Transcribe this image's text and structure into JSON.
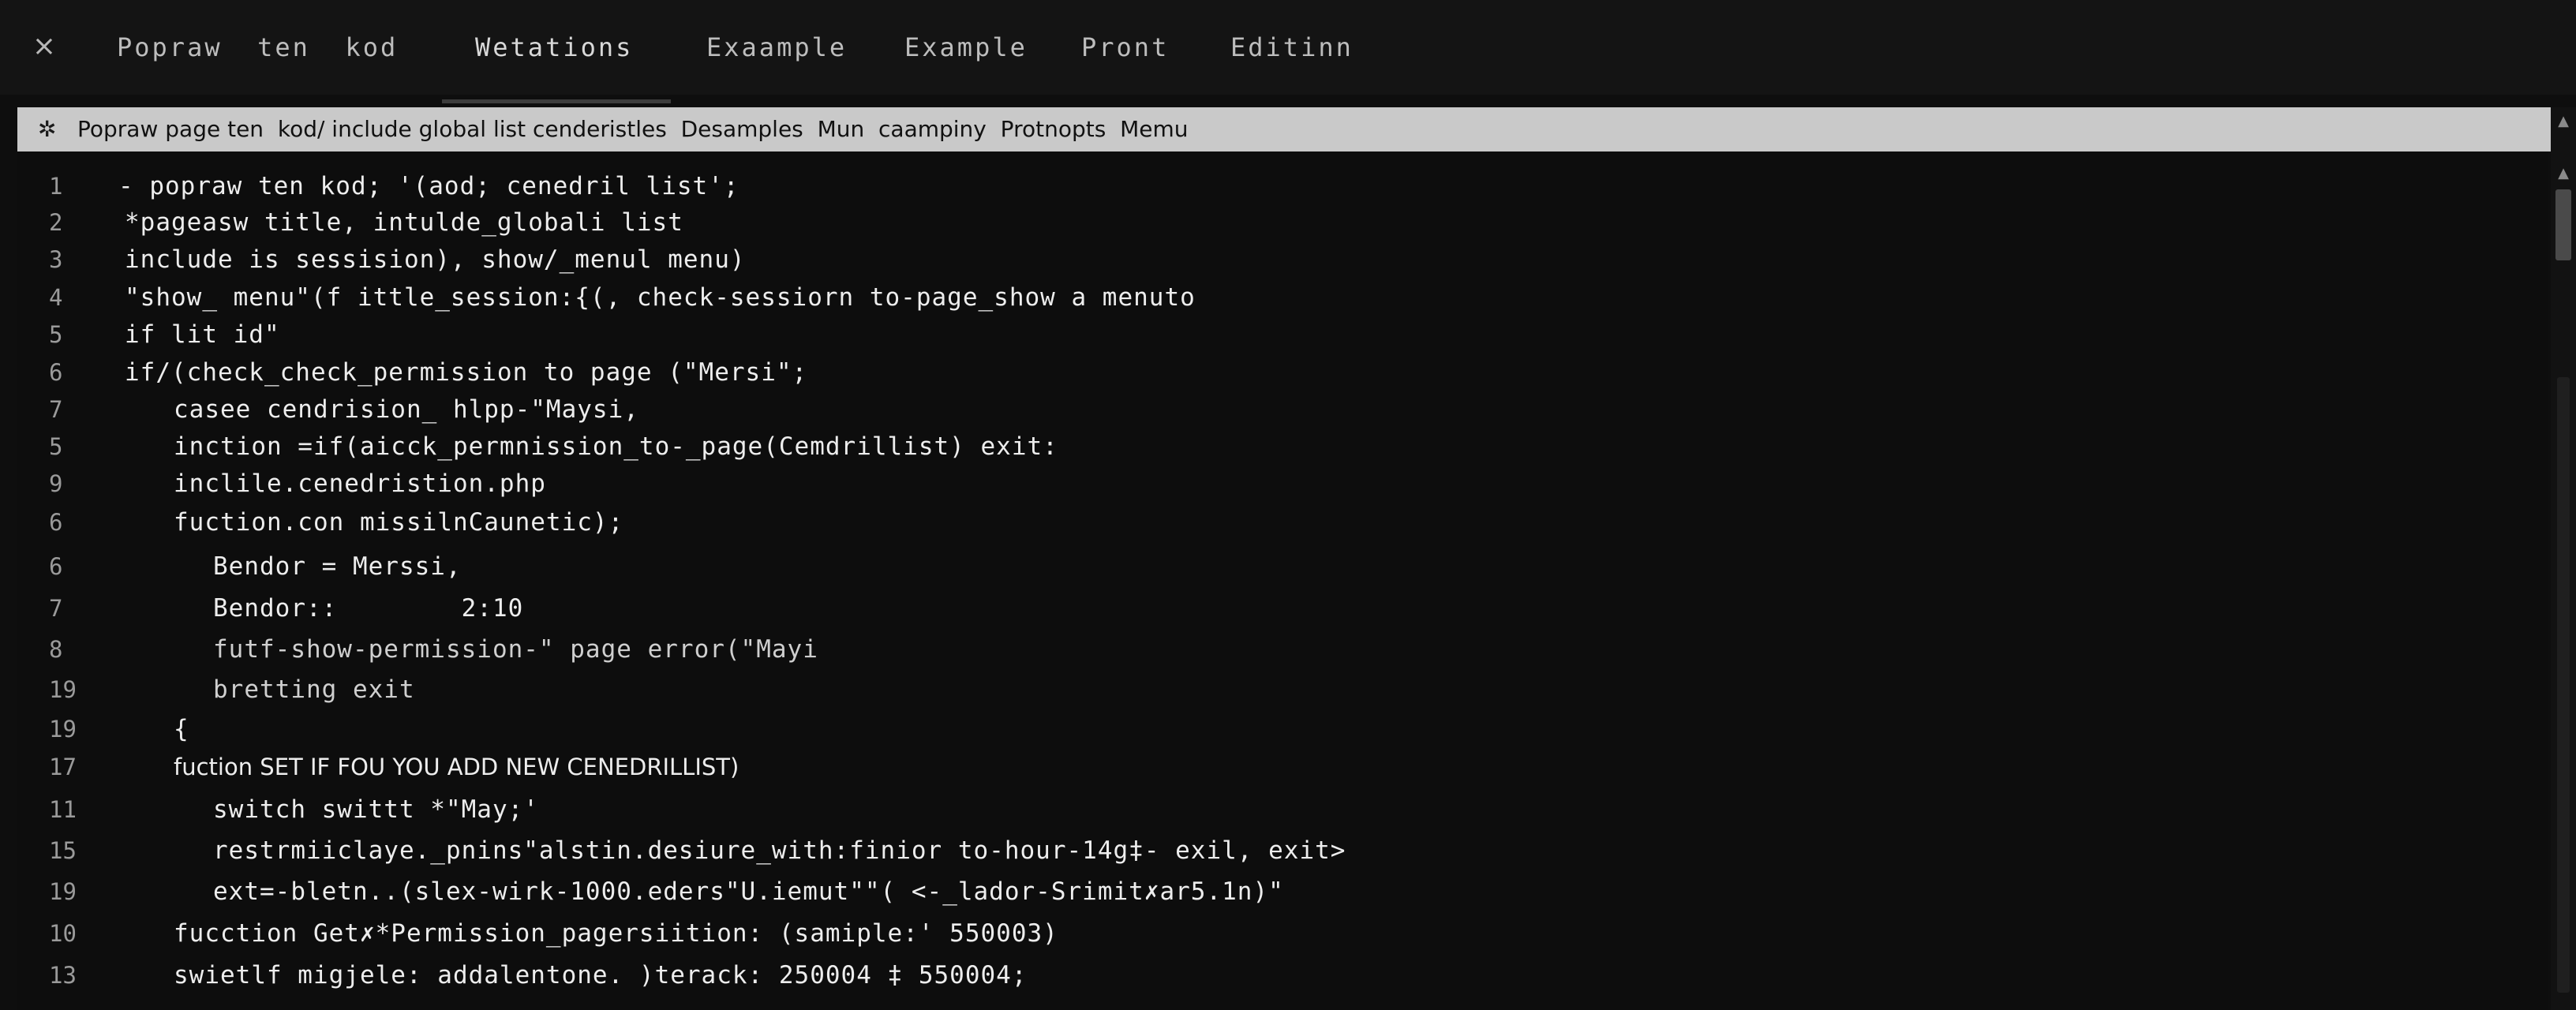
{
  "tabs": {
    "close_glyph": "×",
    "items": [
      {
        "label": "Popraw  ten  kod"
      },
      {
        "label": "Wetations"
      },
      {
        "label": "Exaample"
      },
      {
        "label": "Example"
      },
      {
        "label": "Pront"
      },
      {
        "label": "Editinn"
      }
    ],
    "active_index": 1
  },
  "pathbar": {
    "icon": "settings-icon",
    "text": "Popraw page ten  kod/ include global list cenderistles  Desamples  Mun  caampiny  Protnopts  Memu"
  },
  "editor": {
    "lines": [
      {
        "num": "1",
        "text": "- popraw ten kod; '(aod; cenedril list';"
      },
      {
        "num": "2",
        "text": "*pageasw title, intulde_globali list"
      },
      {
        "num": "3",
        "text": "include is sessision), show/_menul menu)"
      },
      {
        "num": "4",
        "text": "\"show_ menu\"(f ittle_session:{(, check-sessiorn to-page_show a menuto"
      },
      {
        "num": "5",
        "text": "if lit id\""
      },
      {
        "num": "6",
        "text": "if/(check_check_permission to page (\"Mersi\";"
      },
      {
        "num": "7",
        "text": "casee cendrision_ hlpp-\"Maysi,"
      },
      {
        "num": "5",
        "text": "inction =if(aicck_permnission_to-_page(Cemdrillist) exit:"
      },
      {
        "num": "9",
        "text": "inclile.cenedristion.php"
      },
      {
        "num": "6",
        "text": "fuction.con missilnCaunetic);"
      },
      {
        "num": "6",
        "text": "Bendor = Merssi,"
      },
      {
        "num": "7",
        "text": "Bendor::        2:10"
      },
      {
        "num": "8",
        "text": "futf-show-permission-\" page error(\"Mayi"
      },
      {
        "num": "19",
        "text": "bretting exit"
      },
      {
        "num": "19",
        "text": "{"
      },
      {
        "num": "17",
        "text": "fuction SET IF FOU YOU ADD NEW CENEDRILLIST)"
      },
      {
        "num": "11",
        "text": "switch swittt *\"May;'"
      },
      {
        "num": "15",
        "text": "restrmiiclaye._pnins\"alstin.desiure_with:finior to-hour-14g‡- exil, exit>"
      },
      {
        "num": "19",
        "text": "ext=-bletn..(slex-wirk-1000.eders\"U.iemut\"\"( <-_lador-Srimit✗ar5.1n)\""
      },
      {
        "num": "10",
        "text": "fucction Get✗*Permission_pagersiition: (samiple:' 550003)"
      },
      {
        "num": "13",
        "text": "swietlf migjele: addalentone. )terack: 250004 ‡ 550004;"
      }
    ]
  },
  "scrollbar": {
    "up_glyph": "▲"
  },
  "colors": {
    "background": "#0e0e0e",
    "tabbar": "#141414",
    "pathbar": "#c9c9c9",
    "code_text": "#ededed",
    "gutter_text": "#9a9a9a"
  }
}
